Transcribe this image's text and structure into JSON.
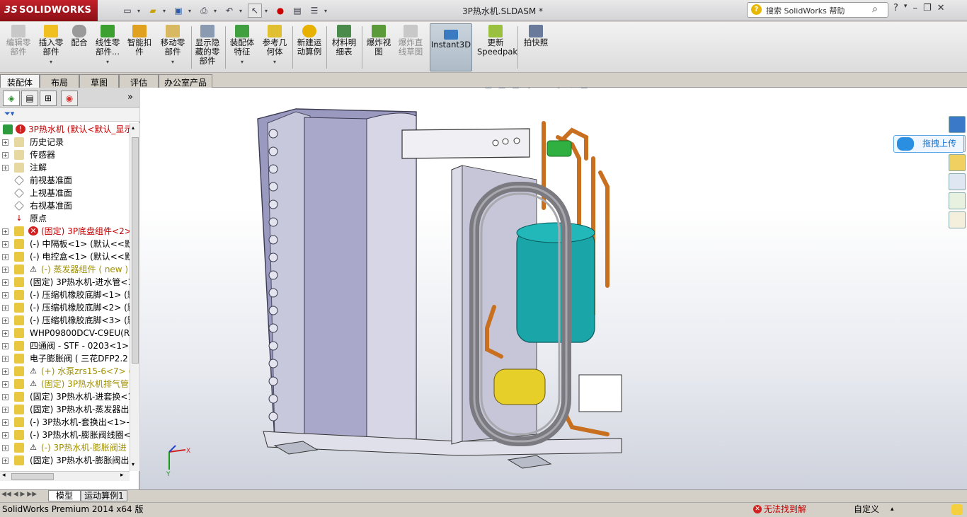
{
  "app": {
    "logo": "SOLIDWORKS",
    "logo_mark": "3S",
    "doc_title": "3P热水机.SLDASM *"
  },
  "search": {
    "placeholder": "搜索 SolidWorks 帮助",
    "help_icon": "?"
  },
  "toolbar": {
    "buttons": [
      {
        "label": "编辑零部件",
        "enabled": false
      },
      {
        "label": "插入零部件",
        "enabled": true
      },
      {
        "label": "配合",
        "enabled": true
      },
      {
        "label": "线性零部件...",
        "enabled": true
      },
      {
        "label": "智能扣件",
        "enabled": true
      },
      {
        "label": "移动零部件",
        "enabled": true
      },
      {
        "label": "显示隐藏的零部件",
        "enabled": true
      },
      {
        "label": "装配体特征",
        "enabled": true
      },
      {
        "label": "参考几何体",
        "enabled": true
      },
      {
        "label": "新建运动算例",
        "enabled": true
      },
      {
        "label": "材料明细表",
        "enabled": true
      },
      {
        "label": "爆炸视图",
        "enabled": true
      },
      {
        "label": "爆炸直线草图",
        "enabled": false
      },
      {
        "label": "Instant3D",
        "enabled": true,
        "active": true
      },
      {
        "label": "更新Speedpak",
        "enabled": true
      },
      {
        "label": "拍快照",
        "enabled": true
      }
    ]
  },
  "tabs": [
    "装配体",
    "布局",
    "草图",
    "评估",
    "办公室产品"
  ],
  "tree": {
    "nodes": [
      {
        "label": "3P热水机  (默认<默认_显示",
        "style": "red"
      },
      {
        "label": "历史记录",
        "style": "normal"
      },
      {
        "label": "传感器",
        "style": "normal"
      },
      {
        "label": "注解",
        "style": "normal"
      },
      {
        "label": "前视基准面",
        "style": "normal"
      },
      {
        "label": "上视基准面",
        "style": "normal"
      },
      {
        "label": "右视基准面",
        "style": "normal"
      },
      {
        "label": "原点",
        "style": "normal"
      },
      {
        "label": "(固定) 3P底盘组件<2>",
        "style": "red"
      },
      {
        "label": "(-) 中隔板<1> (默认<<默",
        "style": "normal"
      },
      {
        "label": "(-) 电控盒<1> (默认<<默",
        "style": "normal"
      },
      {
        "label": "(-) 蒸发器组件 ( new )",
        "style": "olive"
      },
      {
        "label": "(固定) 3P热水机-进水管<1",
        "style": "normal"
      },
      {
        "label": "(-) 压缩机橡胶底脚<1> (默",
        "style": "normal"
      },
      {
        "label": "(-) 压缩机橡胶底脚<2> (默",
        "style": "normal"
      },
      {
        "label": "(-) 压缩机橡胶底脚<3> (默",
        "style": "normal"
      },
      {
        "label": "WHP09800DCV-C9EU(R4",
        "style": "normal"
      },
      {
        "label": "四通阀 - STF - 0203<1> (",
        "style": "normal"
      },
      {
        "label": "电子膨胀阀 ( 三花DFP2.2",
        "style": "normal"
      },
      {
        "label": "(+) 水泵zrs15-6<7> (",
        "style": "olive"
      },
      {
        "label": "(固定) 3P热水机排气管",
        "style": "olive"
      },
      {
        "label": "(固定) 3P热水机-进套换<1",
        "style": "normal"
      },
      {
        "label": "(固定) 3P热水机-蒸发器出",
        "style": "normal"
      },
      {
        "label": "(-) 3P热水机-套换出<1>-",
        "style": "normal"
      },
      {
        "label": "(-) 3P热水机-膨胀阀线圈<",
        "style": "normal"
      },
      {
        "label": "(-) 3P热水机-膨胀阀进",
        "style": "olive"
      },
      {
        "label": "(固定) 3P热水机-膨胀阀出",
        "style": "normal"
      }
    ]
  },
  "bottom_tabs": [
    "模型",
    "运动算例1"
  ],
  "status": {
    "product": "SolidWorks Premium 2014 x64 版",
    "error": "无法找到解",
    "custom": "自定义"
  },
  "upload_button": "拖拽上传",
  "triad": {
    "x": "X",
    "y": "Y"
  }
}
